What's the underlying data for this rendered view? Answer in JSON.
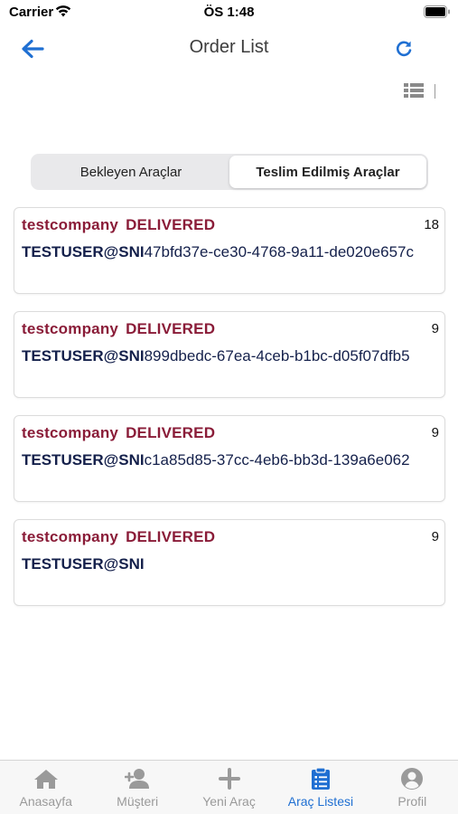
{
  "status_bar": {
    "carrier": "Carrier",
    "time": "ÖS 1:48"
  },
  "header": {
    "title": "Order List"
  },
  "colors": {
    "accent": "#1f6fd2",
    "company": "#8a1c38",
    "user": "#14204b",
    "inactive": "#9a9a9a"
  },
  "segments": [
    {
      "label": "Bekleyen Araçlar",
      "active": false
    },
    {
      "label": "Teslim Edilmiş Araçlar",
      "active": true
    }
  ],
  "orders": [
    {
      "company": "testcompany",
      "status": "DELIVERED",
      "count": "18",
      "user": "TESTUSER@SNI",
      "id": "47bfd37e-ce30-4768-9a11-de020e657c"
    },
    {
      "company": "testcompany",
      "status": "DELIVERED",
      "count": "9",
      "user": "TESTUSER@SNI",
      "id": "899dbedc-67ea-4ceb-b1bc-d05f07dfb5"
    },
    {
      "company": "testcompany",
      "status": "DELIVERED",
      "count": "9",
      "user": "TESTUSER@SNI",
      "id": "c1a85d85-37cc-4eb6-bb3d-139a6e062"
    },
    {
      "company": "testcompany",
      "status": "DELIVERED",
      "count": "9",
      "user": "TESTUSER@SNI",
      "id": ""
    }
  ],
  "tabs": [
    {
      "label": "Anasayfa",
      "icon": "home-icon"
    },
    {
      "label": "Müşteri",
      "icon": "add-user-icon"
    },
    {
      "label": "Yeni Araç",
      "icon": "plus-icon"
    },
    {
      "label": "Araç Listesi",
      "icon": "clipboard-list-icon",
      "active": true
    },
    {
      "label": "Profil",
      "icon": "profile-icon"
    }
  ]
}
